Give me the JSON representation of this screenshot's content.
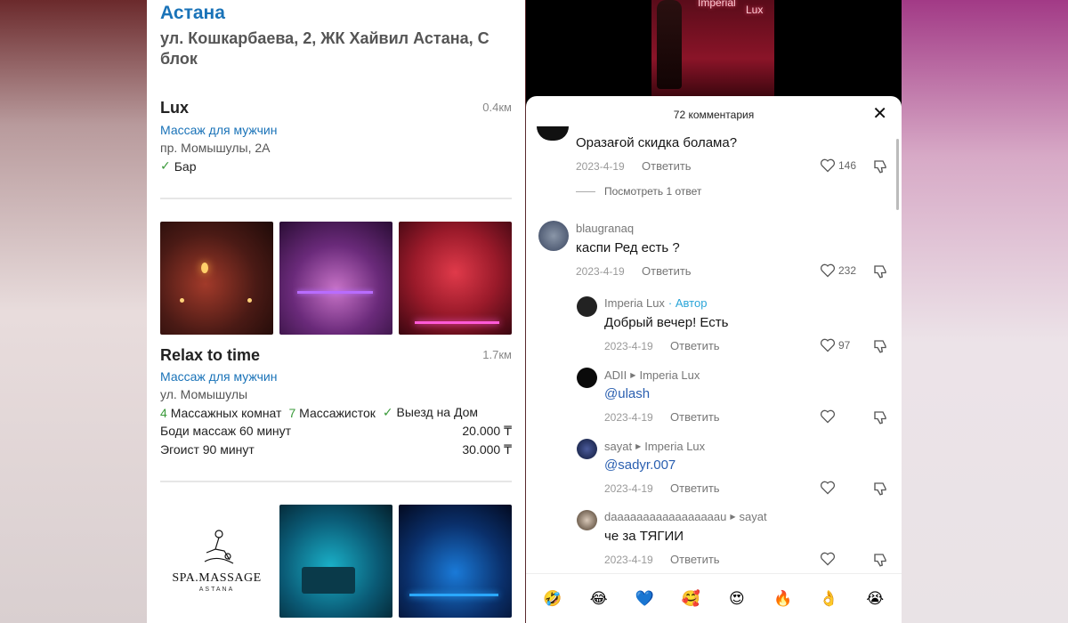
{
  "left": {
    "city": "Астана",
    "address": "ул. Кошкарбаева, 2, ЖК Хайвил Астана, С блок",
    "listings": [
      {
        "name": "Lux",
        "distance": "0.4км",
        "category": "Массаж для мужчин",
        "address": "пр. Момышулы, 2А",
        "feature": "Бар"
      },
      {
        "name": "Relax to time",
        "distance": "1.7км",
        "category": "Массаж для мужчин",
        "address": "ул. Момышулы",
        "rooms_count": "4",
        "rooms_label": "Массажных комнат",
        "masseuses_count": "7",
        "masseuses_label": "Массажисток",
        "outcall": "Выезд на Дом",
        "prices": [
          {
            "service": "Боди массаж 60 минут",
            "price": "20.000 ₸"
          },
          {
            "service": "Эгоист 90 минут",
            "price": "30.000 ₸"
          }
        ]
      },
      {
        "logo_text": "SPA.MASSAGE",
        "logo_sub": "ASTANA"
      }
    ]
  },
  "phone": {
    "video_neon": [
      "Imperial",
      "Lux"
    ],
    "comments_title": "72 комментария",
    "view_replies": "Посмотреть 1 ответ",
    "reply_label": "Ответить",
    "comments": [
      {
        "user": "",
        "text": "Оразағой скидка болама?",
        "date": "2023-4-19",
        "likes": "146"
      },
      {
        "user": "blaugranaq",
        "text": "каспи Ред есть ?",
        "date": "2023-4-19",
        "likes": "232"
      },
      {
        "user": "Imperia  Lux",
        "badge": "· Автор",
        "text": "Добрый вечер! Есть",
        "date": "2023-4-19",
        "likes": "97"
      },
      {
        "user": "ADII",
        "reply_to": "Imperia  Lux",
        "text": "@ulash",
        "date": "2023-4-19",
        "likes": ""
      },
      {
        "user": "sayat",
        "reply_to": "Imperia  Lux",
        "text": "@sadyr.007",
        "date": "2023-4-19",
        "likes": ""
      },
      {
        "user": "daaaaaaaaaaaaaaaaau",
        "reply_to": "sayat",
        "text": "че за ТЯГИИ",
        "date": "2023-4-19",
        "likes": ""
      }
    ],
    "emojis": [
      "🤣",
      "😂",
      "💙",
      "🥰",
      "😍",
      "🔥",
      "👌",
      "😭"
    ],
    "colors": {
      "link": "#1a73b8",
      "mention": "#2a5fb0",
      "author": "#2aa5d8",
      "check": "#3a9a3a"
    }
  }
}
